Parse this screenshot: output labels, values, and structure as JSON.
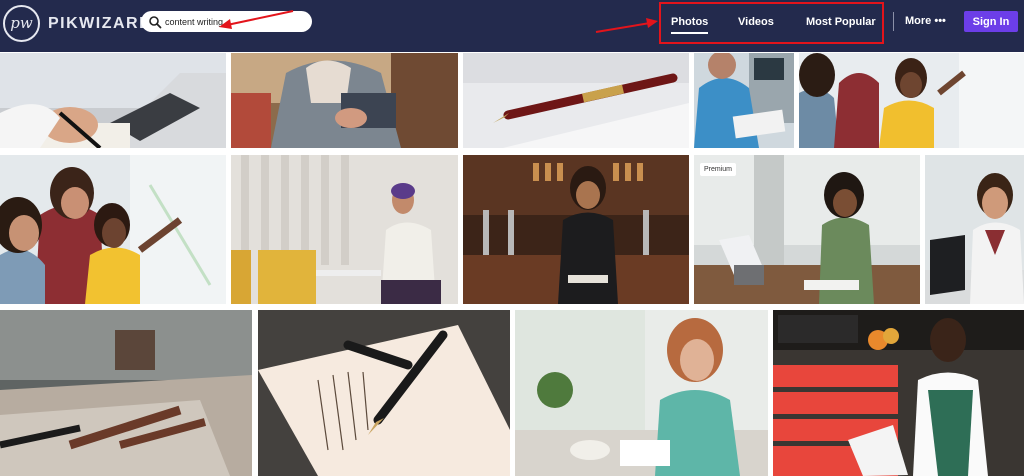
{
  "brand": {
    "logo_mark": "pw",
    "name": "PIKWIZARD"
  },
  "search": {
    "value": "content writing",
    "icon": "search-icon"
  },
  "nav": {
    "items": [
      {
        "label": "Photos",
        "active": true
      },
      {
        "label": "Videos",
        "active": false
      },
      {
        "label": "Most Popular",
        "active": false
      }
    ],
    "more_label": "More",
    "more_icon": "dots-icon",
    "signin_label": "Sign In"
  },
  "annotations": {
    "highlight_color": "#e3141b"
  },
  "colors": {
    "header_bg": "#232a4d",
    "signin_bg": "#6c3ee8"
  },
  "gallery": {
    "badge_label": "Premium",
    "photos": [
      {
        "subject": "hand writing with pen beside laptop"
      },
      {
        "subject": "man using tablet in office"
      },
      {
        "subject": "fountain pen on paper"
      },
      {
        "subject": "nurse writing on clipboard"
      },
      {
        "subject": "two women writing on glass board"
      },
      {
        "subject": "team writing on glass board"
      },
      {
        "subject": "woman sitting with notebook"
      },
      {
        "subject": "bartender holding notepad"
      },
      {
        "subject": "woman writing in notebook at desk",
        "premium": true
      },
      {
        "subject": "man working on laptop"
      },
      {
        "subject": "pencils on wooden table"
      },
      {
        "subject": "fountain pen on handwritten page"
      },
      {
        "subject": "woman writing at cafe table"
      },
      {
        "subject": "grocer writing on clipboard"
      }
    ]
  }
}
